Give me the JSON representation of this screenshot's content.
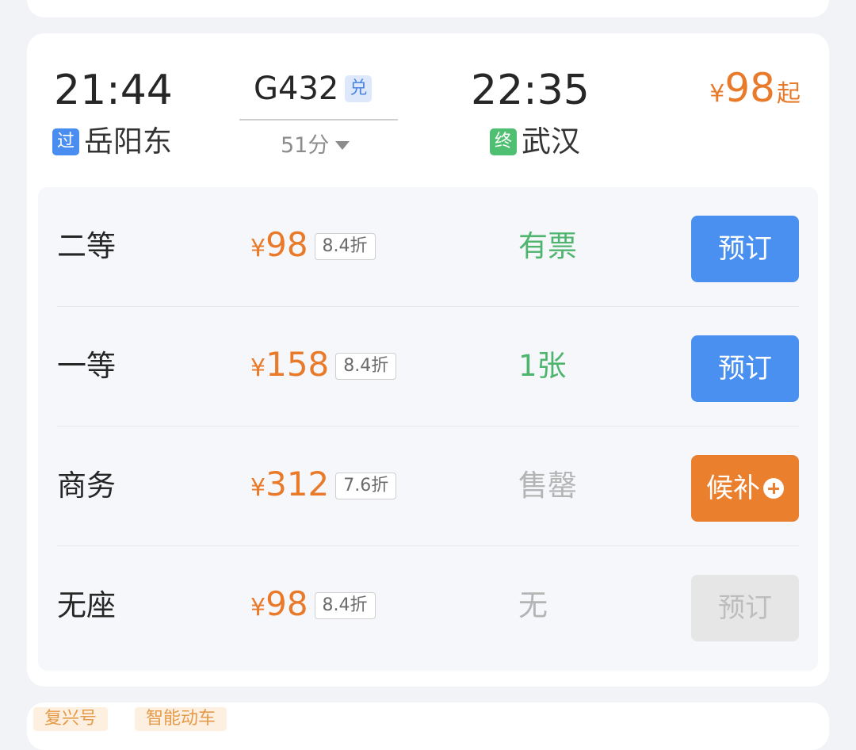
{
  "train": {
    "departure_time": "21:44",
    "departure_station": "岳阳东",
    "departure_tag": "过",
    "train_number": "G432",
    "train_badge": "兑",
    "duration": "51分",
    "arrival_time": "22:35",
    "arrival_station": "武汉",
    "arrival_tag": "终",
    "min_price_currency": "¥",
    "min_price": "98",
    "min_price_suffix": "起"
  },
  "seats": [
    {
      "name": "二等",
      "currency": "¥",
      "price": "98",
      "discount": "8.4折",
      "availability": "有票",
      "availability_color": "#4fb56e",
      "action": "预订",
      "action_style": "primary"
    },
    {
      "name": "一等",
      "currency": "¥",
      "price": "158",
      "discount": "8.4折",
      "availability": "1张",
      "availability_color": "#4fb56e",
      "action": "预订",
      "action_style": "primary"
    },
    {
      "name": "商务",
      "currency": "¥",
      "price": "312",
      "discount": "7.6折",
      "availability": "售罄",
      "availability_color": "#b4b4b4",
      "action": "候补",
      "action_style": "waitlist"
    },
    {
      "name": "无座",
      "currency": "¥",
      "price": "98",
      "discount": "8.4折",
      "availability": "无",
      "availability_color": "#b4b4b4",
      "action": "预订",
      "action_style": "disabled"
    }
  ],
  "bottom_tags": [
    "复兴号",
    "智能动车"
  ],
  "colors": {
    "accent_orange": "#e97a2a",
    "button_blue": "#4a90f0",
    "available_green": "#4fb56e",
    "unavailable_gray": "#b4b4b4"
  }
}
